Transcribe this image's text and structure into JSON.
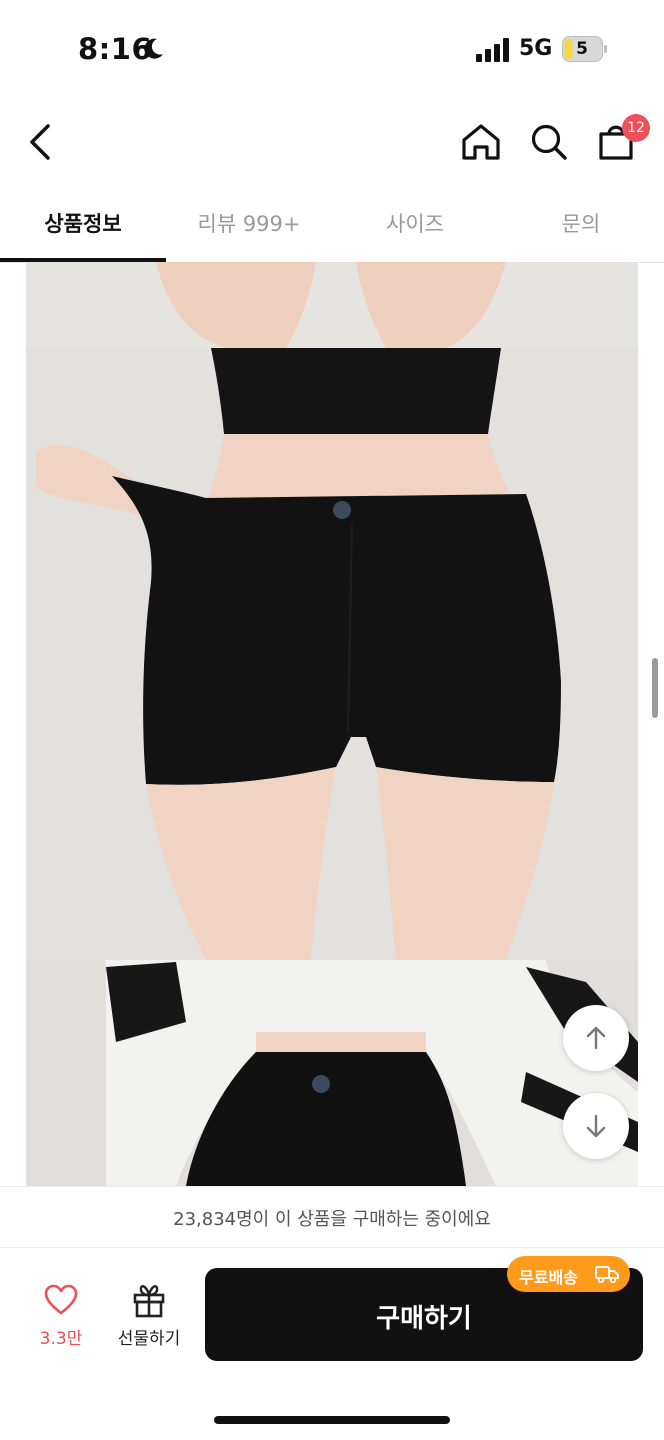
{
  "status_bar": {
    "time": "8:16",
    "network": "5G",
    "battery": "5"
  },
  "nav": {
    "cart_count": "12"
  },
  "tabs": [
    {
      "label": "상품정보",
      "active": true
    },
    {
      "label": "리뷰 999+",
      "active": false
    },
    {
      "label": "사이즈",
      "active": false
    },
    {
      "label": "문의",
      "active": false
    }
  ],
  "buyers_banner": "23,834명이 이 상품을 구매하는 중이에요",
  "bottom_bar": {
    "like_count": "3.3만",
    "gift_label": "선물하기",
    "buy_label": "구매하기",
    "badge_label": "무료배송"
  },
  "colors": {
    "accent_red": "#ef4f58",
    "badge_orange": "#ff9a1a",
    "button_black": "#111111"
  },
  "icons": [
    "back-icon",
    "home-icon",
    "search-icon",
    "cart-icon",
    "heart-icon",
    "gift-icon",
    "arrow-up-icon",
    "arrow-down-icon",
    "truck-icon",
    "moon-icon",
    "signal-icon",
    "battery-icon"
  ]
}
